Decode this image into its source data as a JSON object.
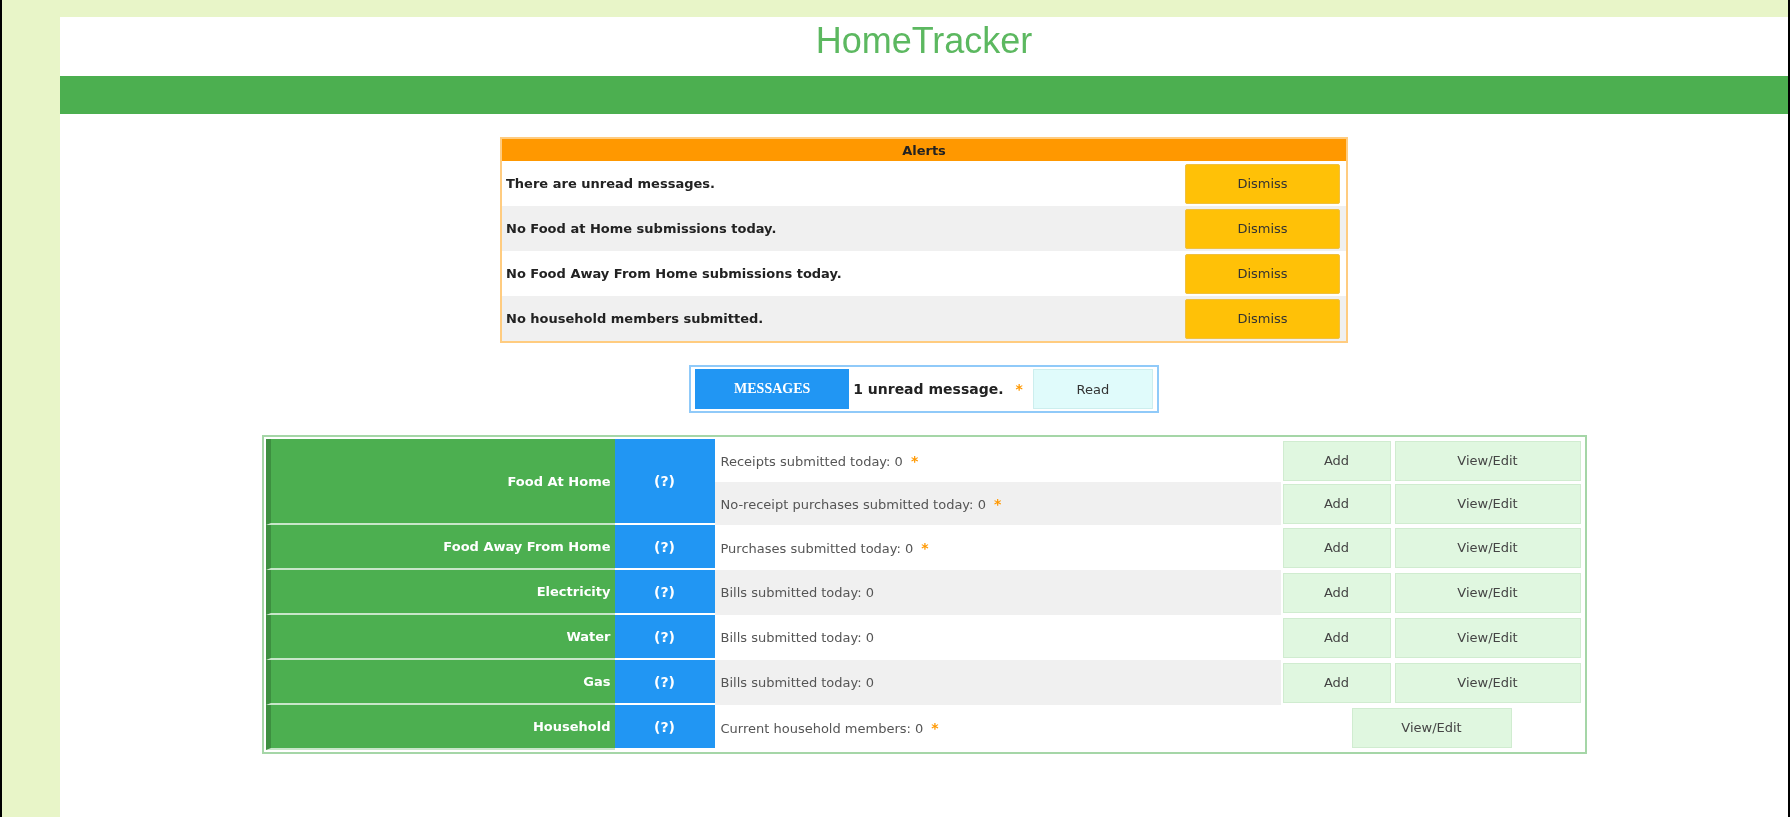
{
  "header": {
    "title": "HomeTracker"
  },
  "alerts": {
    "title": "Alerts",
    "items": [
      {
        "text": "There are unread messages.",
        "button": "Dismiss"
      },
      {
        "text": "No Food at Home submissions today.",
        "button": "Dismiss"
      },
      {
        "text": "No Food Away From Home submissions today.",
        "button": "Dismiss"
      },
      {
        "text": "No household members submitted.",
        "button": "Dismiss"
      }
    ]
  },
  "messages": {
    "label": "MESSAGES",
    "text": "1 unread message.",
    "note": "*",
    "button": "Read"
  },
  "categories": [
    {
      "label": "Food At Home",
      "help": "(?)",
      "items": [
        {
          "text": "Receipts submitted today: 0",
          "note": "*",
          "buttons": [
            "Add",
            "View/Edit"
          ]
        },
        {
          "text": "No-receipt purchases submitted today: 0",
          "note": "*",
          "buttons": [
            "Add",
            "View/Edit"
          ]
        }
      ]
    },
    {
      "label": "Food Away From Home",
      "help": "(?)",
      "items": [
        {
          "text": "Purchases submitted today: 0",
          "note": "*",
          "buttons": [
            "Add",
            "View/Edit"
          ]
        }
      ]
    },
    {
      "label": "Electricity",
      "help": "(?)",
      "items": [
        {
          "text": "Bills submitted today: 0",
          "buttons": [
            "Add",
            "View/Edit"
          ]
        }
      ]
    },
    {
      "label": "Water",
      "help": "(?)",
      "items": [
        {
          "text": "Bills submitted today: 0",
          "buttons": [
            "Add",
            "View/Edit"
          ]
        }
      ]
    },
    {
      "label": "Gas",
      "help": "(?)",
      "items": [
        {
          "text": "Bills submitted today: 0",
          "buttons": [
            "Add",
            "View/Edit"
          ]
        }
      ]
    },
    {
      "label": "Household",
      "help": "(?)",
      "items": [
        {
          "text": "Current household members: 0",
          "note": "*",
          "buttons": [
            "View/Edit"
          ]
        }
      ]
    }
  ]
}
